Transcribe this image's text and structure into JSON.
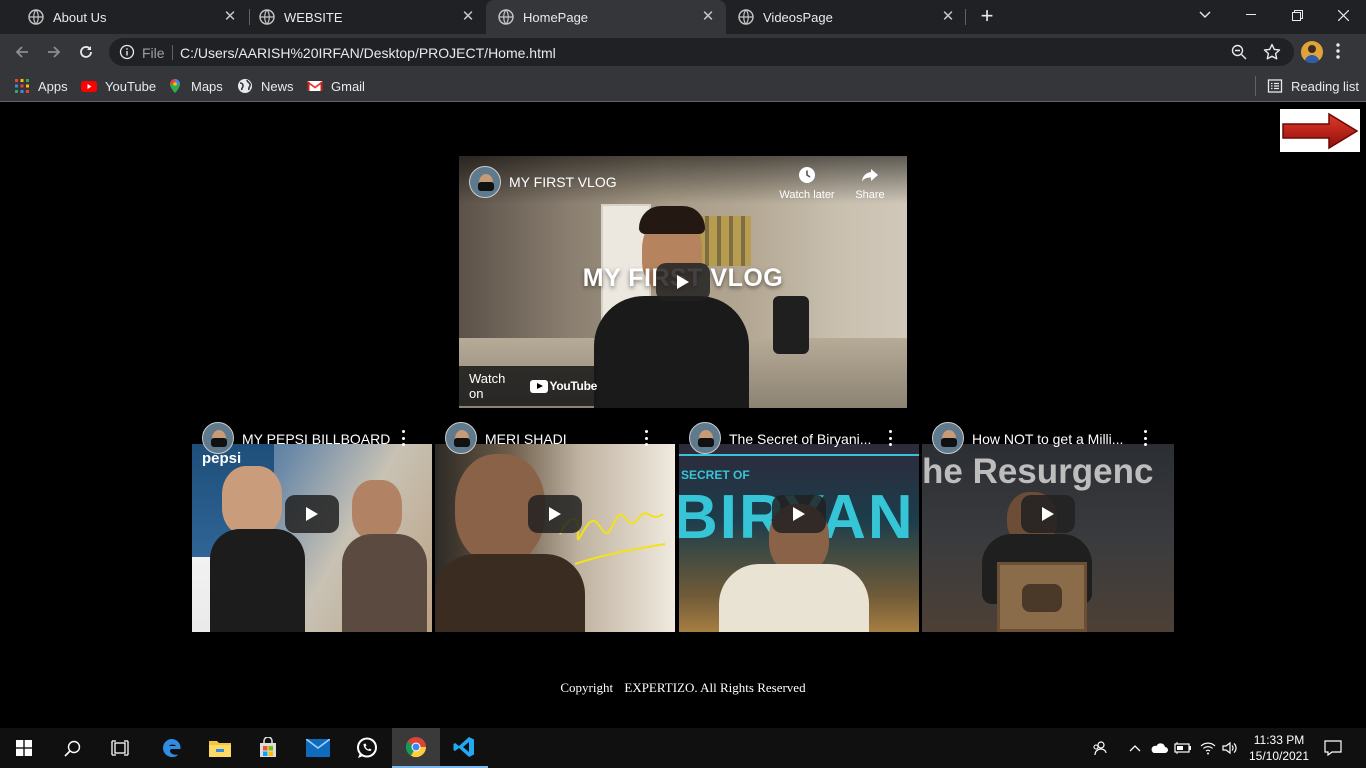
{
  "browser": {
    "tabs": [
      {
        "label": "About Us",
        "active": false
      },
      {
        "label": "WEBSITE",
        "active": false
      },
      {
        "label": "HomePage",
        "active": true
      },
      {
        "label": "VideosPage",
        "active": false
      }
    ],
    "address": {
      "scheme_label": "File",
      "url": "C:/Users/AARISH%20IRFAN/Desktop/PROJECT/Home.html"
    },
    "bookmarks": [
      {
        "label": "Apps",
        "icon": "apps-grid-icon"
      },
      {
        "label": "YouTube",
        "icon": "youtube-icon"
      },
      {
        "label": "Maps",
        "icon": "maps-icon"
      },
      {
        "label": "News",
        "icon": "globe-icon"
      },
      {
        "label": "Gmail",
        "icon": "gmail-icon"
      }
    ],
    "reading_list": "Reading list"
  },
  "page": {
    "main_video": {
      "title": "MY FIRST VLOG",
      "overlay_text": "MY FIRST VLOG",
      "watch_later": "Watch later",
      "share": "Share",
      "watch_on": "Watch on",
      "youtube": "YouTube"
    },
    "videos": [
      {
        "title": "MY PEPSI BILLBOARD"
      },
      {
        "title": "MERI SHADI"
      },
      {
        "title": "The Secret of Biryani..."
      },
      {
        "title": "How NOT to get a Milli..."
      }
    ],
    "thumb_text": {
      "pepsi": "pepsi",
      "v3_top": "SECRET OF",
      "v3_big": "BIRYAN",
      "v4_big": "he Resurgenc"
    },
    "footer": {
      "copyright": "Copyright",
      "company": "EXPERTIZO. All Rights Reserved"
    }
  },
  "taskbar": {
    "time": "11:33 PM",
    "date": "15/10/2021"
  },
  "colors": {
    "accent_red": "#cc1f1a",
    "taskbar_highlight": "#7eb6f0"
  }
}
